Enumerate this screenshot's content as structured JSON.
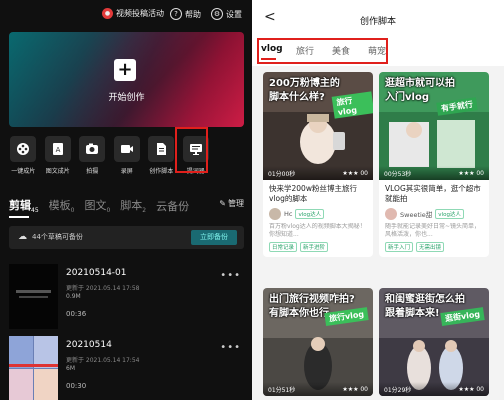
{
  "left": {
    "topbar": {
      "promo_label": "视频投稿活动",
      "help_label": "帮助",
      "settings_label": "设置"
    },
    "hero": {
      "label": "开始创作"
    },
    "tools": [
      {
        "label": "一键成片",
        "icon": "film-reel-icon"
      },
      {
        "label": "图文成片",
        "icon": "image-text-icon"
      },
      {
        "label": "拍摄",
        "icon": "camera-icon"
      },
      {
        "label": "录屏",
        "icon": "screen-record-icon"
      },
      {
        "label": "创作脚本",
        "icon": "script-document-icon"
      },
      {
        "label": "提词器",
        "icon": "teleprompter-icon"
      }
    ],
    "tabs": [
      {
        "label": "剪辑",
        "count": "45",
        "active": true
      },
      {
        "label": "模板",
        "count": "0"
      },
      {
        "label": "图文",
        "count": "0"
      },
      {
        "label": "脚本",
        "count": "2"
      },
      {
        "label": "云备份",
        "count": ""
      }
    ],
    "manage_label": "管理",
    "backup": {
      "text": "44个草稿可备份",
      "button": "立即备份"
    },
    "drafts": [
      {
        "name": "20210514-01",
        "updated": "更新于 2021.05.14 17:58",
        "size": "0.9M",
        "duration": "00:36"
      },
      {
        "name": "20210514",
        "updated": "更新于 2021.05.14 17:54",
        "size": "6M",
        "duration": "00:30"
      }
    ]
  },
  "right": {
    "title": "创作脚本",
    "tabs": [
      {
        "label": "vlog",
        "active": true
      },
      {
        "label": "旅行"
      },
      {
        "label": "美食"
      },
      {
        "label": "萌宠"
      }
    ],
    "cards": [
      {
        "overlay_title_1": "200万粉博主的",
        "overlay_title_2": "脚本什么样?",
        "ribbon": "旅行vlog",
        "stats_left": "01分00秒",
        "stats_right": "★★★ 00",
        "text": "快来学200w粉丝博主旅行vlog的脚本",
        "author": "Hc",
        "badge": "vlog达人",
        "desc": "百万粉vlog达人的视频脚本大揭秘！你想知道...",
        "tags": [
          "日常记录",
          "新手进阶"
        ]
      },
      {
        "overlay_title_1": "逛超市就可以拍",
        "overlay_title_2": "入门vlog",
        "ribbon": "有手就行",
        "stats_left": "00分53秒",
        "stats_right": "★★★ 00",
        "text": "VLOG其实很简单，逛个超市就能拍",
        "author": "Sweetie甜",
        "badge": "vlog达人",
        "desc": "随手就能记录美好日常~镜头简单，风格活泼，你也...",
        "tags": [
          "新手入门",
          "无需出镜"
        ]
      },
      {
        "overlay_title_1": "出门旅行视频咋拍?",
        "overlay_title_2": "有脚本你也行",
        "ribbon": "旅行vlog",
        "stats_left": "01分51秒",
        "stats_right": "★★★ 00"
      },
      {
        "overlay_title_1": "和闺蜜逛街怎么拍",
        "overlay_title_2": "跟着脚本来!",
        "ribbon": "逛街vlog",
        "stats_left": "01分29秒",
        "stats_right": "★★★ 00"
      }
    ]
  }
}
